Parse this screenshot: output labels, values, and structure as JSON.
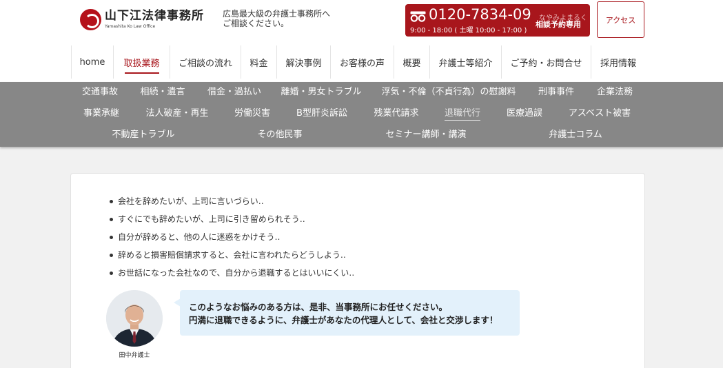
{
  "header": {
    "logo_name": "山下江法律事務所",
    "logo_sub": "Yamashita Ko Law Office",
    "tagline_line1": "広島最大級の弁護士事務所へ",
    "tagline_line2": "ご相談ください。",
    "phone_number": "0120-7834-09",
    "phone_ruby": "なやみよまるく",
    "phone_hours": "9:00 - 18:00 ( 土曜 10:00 - 17:00 )",
    "phone_label": "相談予約専用",
    "access_label": "アクセス",
    "brand_color": "#a8161c"
  },
  "nav": [
    {
      "label": "home"
    },
    {
      "label": "取扱業務",
      "active": true
    },
    {
      "label": "ご相談の流れ"
    },
    {
      "label": "料金"
    },
    {
      "label": "解決事例"
    },
    {
      "label": "お客様の声"
    },
    {
      "label": "概要"
    },
    {
      "label": "弁護士等紹介"
    },
    {
      "label": "ご予約・お問合せ"
    },
    {
      "label": "採用情報"
    }
  ],
  "subnav": [
    {
      "label": "交通事故"
    },
    {
      "label": "相続・遺言"
    },
    {
      "label": "借金・過払い"
    },
    {
      "label": "離婚・男女トラブル"
    },
    {
      "label": "浮気・不倫（不貞行為）の慰謝料"
    },
    {
      "label": "刑事事件"
    },
    {
      "label": "企業法務"
    },
    {
      "label": "事業承継"
    },
    {
      "label": "法人破産・再生"
    },
    {
      "label": "労働災害"
    },
    {
      "label": "B型肝炎訴訟"
    },
    {
      "label": "残業代請求"
    },
    {
      "label": "退職代行",
      "current": true
    },
    {
      "label": "医療過誤"
    },
    {
      "label": "アスベスト被害"
    },
    {
      "label": "不動産トラブル"
    },
    {
      "label": "その他民事"
    },
    {
      "label": "セミナー講師・講演"
    },
    {
      "label": "弁護士コラム"
    }
  ],
  "content": {
    "concerns": [
      "会社を辞めたいが、上司に言いづらい‥",
      "すぐにでも辞めたいが、上司に引き留められそう‥",
      "自分が辞めると、他の人に迷惑をかけそう‥",
      "辞めると損害賠償請求すると、会社に言われたらどうしよう‥",
      "お世話になった会社なので、自分から退職するとはいいにくい‥"
    ],
    "lawyer_caption": "田中弁護士",
    "bubble_line1": "このようなお悩みのある方は、是非、当事務所にお任せください。",
    "bubble_line2": "円満に退職できるように、弁護士があなたの代理人として、会社と交渉します！"
  }
}
